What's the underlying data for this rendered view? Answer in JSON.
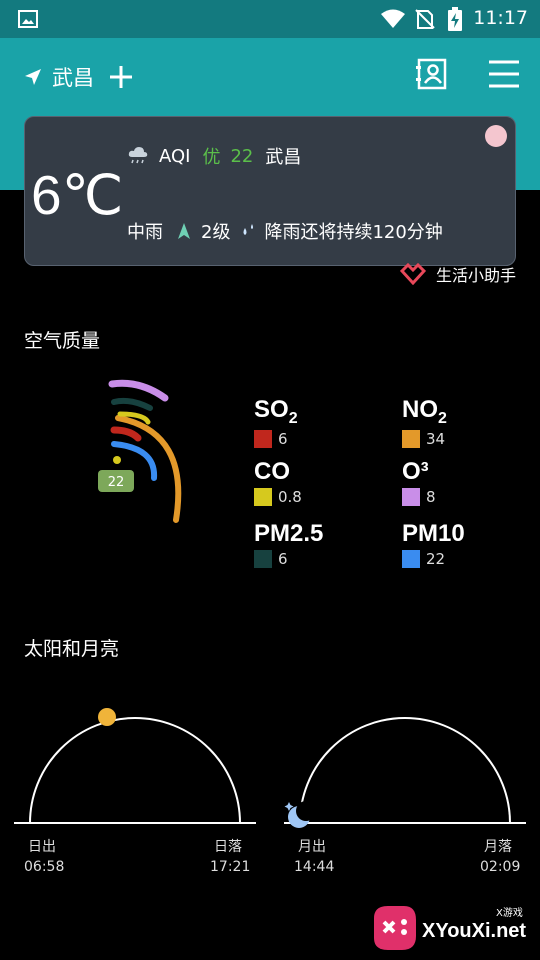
{
  "status_bar": {
    "time": "11:17",
    "icons": [
      "image-icon",
      "wifi-icon",
      "no-sim-icon",
      "battery-charging-icon"
    ]
  },
  "header": {
    "location": "武昌",
    "icons": [
      "location-arrow-icon",
      "add-icon",
      "contacts-card-icon",
      "menu-icon"
    ]
  },
  "weather_card": {
    "temperature": "6℃",
    "aqi_label": "AQI",
    "aqi_level": "优",
    "aqi_value": "22",
    "city": "武昌",
    "condition": "中雨",
    "wind_level": "2级",
    "forecast": "降雨还将持续120分钟",
    "colors": {
      "card_bg": "#343c46",
      "good": "#5bbf4a"
    }
  },
  "life_helper": {
    "label": "生活小助手"
  },
  "air_quality": {
    "title": "空气质量",
    "aqi_badge": "22",
    "pollutants": [
      {
        "name": "SO",
        "sub": "2",
        "value": "6",
        "color": "#c0271d"
      },
      {
        "name": "NO",
        "sub": "2",
        "value": "34",
        "color": "#e3992a"
      },
      {
        "name": "CO",
        "sub": "",
        "value": "0.8",
        "color": "#d6c91e"
      },
      {
        "name": "O³",
        "sub": "",
        "value": "8",
        "color": "#c98ee8"
      },
      {
        "name": "PM2.5",
        "sub": "",
        "value": "6",
        "color": "#17413f"
      },
      {
        "name": "PM10",
        "sub": "",
        "value": "22",
        "color": "#3a8cf0"
      }
    ]
  },
  "sun_moon": {
    "title": "太阳和月亮",
    "sunrise_label": "日出",
    "sunrise_time": "06:58",
    "sunset_label": "日落",
    "sunset_time": "17:21",
    "moonrise_label": "月出",
    "moonrise_time": "14:44",
    "moonset_label": "月落",
    "moonset_time": "02:09",
    "colors": {
      "sun": "#f0b43a",
      "moon": "#9fc6f5"
    }
  },
  "watermark": {
    "text": "XYouXi.net",
    "tag": "X游戏"
  }
}
